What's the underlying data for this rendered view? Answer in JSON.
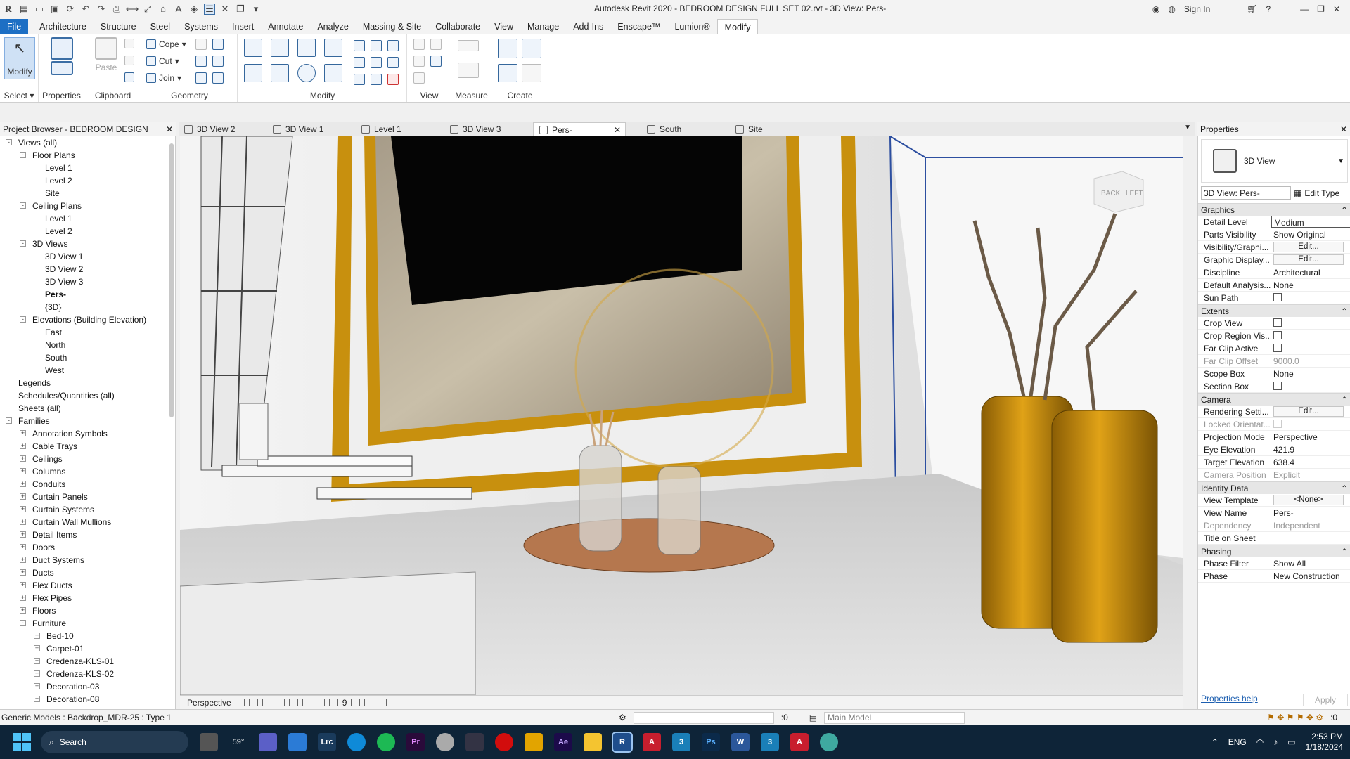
{
  "app": {
    "title": "Autodesk Revit 2020 - BEDROOM DESIGN FULL SET 02.rvt - 3D View: Pers-",
    "sign_in": "Sign In"
  },
  "ribbon_tabs": [
    "File",
    "Architecture",
    "Structure",
    "Steel",
    "Systems",
    "Insert",
    "Annotate",
    "Analyze",
    "Massing & Site",
    "Collaborate",
    "View",
    "Manage",
    "Add-Ins",
    "Enscape™",
    "Lumion®",
    "Modify"
  ],
  "active_tab": "Modify",
  "ribbon": {
    "select": {
      "modify_label": "Modify",
      "panel": "Select"
    },
    "properties": {
      "label": "Properties"
    },
    "clipboard": {
      "paste": "Paste",
      "panel": "Clipboard"
    },
    "geometry": {
      "cope": "Cope",
      "cut": "Cut",
      "join": "Join",
      "panel": "Geometry"
    },
    "modify_panel": "Modify",
    "view_panel": "View",
    "measure_panel": "Measure",
    "create_panel": "Create"
  },
  "project_browser": {
    "title": "Project Browser - BEDROOM DESIGN FUL...",
    "rows": [
      {
        "label": "Views (all)",
        "level": 0,
        "exp": "-"
      },
      {
        "label": "Floor Plans",
        "level": 1,
        "exp": "-"
      },
      {
        "label": "Level 1",
        "level": 2,
        "exp": ""
      },
      {
        "label": "Level 2",
        "level": 2,
        "exp": ""
      },
      {
        "label": "Site",
        "level": 2,
        "exp": ""
      },
      {
        "label": "Ceiling Plans",
        "level": 1,
        "exp": "-"
      },
      {
        "label": "Level 1",
        "level": 2,
        "exp": ""
      },
      {
        "label": "Level 2",
        "level": 2,
        "exp": ""
      },
      {
        "label": "3D Views",
        "level": 1,
        "exp": "-"
      },
      {
        "label": "3D View 1",
        "level": 2,
        "exp": ""
      },
      {
        "label": "3D View 2",
        "level": 2,
        "exp": ""
      },
      {
        "label": "3D View 3",
        "level": 2,
        "exp": ""
      },
      {
        "label": "Pers-",
        "level": 2,
        "exp": "",
        "bold": true
      },
      {
        "label": "{3D}",
        "level": 2,
        "exp": ""
      },
      {
        "label": "Elevations (Building Elevation)",
        "level": 1,
        "exp": "-"
      },
      {
        "label": "East",
        "level": 2,
        "exp": ""
      },
      {
        "label": "North",
        "level": 2,
        "exp": ""
      },
      {
        "label": "South",
        "level": 2,
        "exp": ""
      },
      {
        "label": "West",
        "level": 2,
        "exp": ""
      },
      {
        "label": "Legends",
        "level": 0,
        "exp": ""
      },
      {
        "label": "Schedules/Quantities (all)",
        "level": 0,
        "exp": ""
      },
      {
        "label": "Sheets (all)",
        "level": 0,
        "exp": ""
      },
      {
        "label": "Families",
        "level": 0,
        "exp": "-"
      },
      {
        "label": "Annotation Symbols",
        "level": 1,
        "exp": "+"
      },
      {
        "label": "Cable Trays",
        "level": 1,
        "exp": "+"
      },
      {
        "label": "Ceilings",
        "level": 1,
        "exp": "+"
      },
      {
        "label": "Columns",
        "level": 1,
        "exp": "+"
      },
      {
        "label": "Conduits",
        "level": 1,
        "exp": "+"
      },
      {
        "label": "Curtain Panels",
        "level": 1,
        "exp": "+"
      },
      {
        "label": "Curtain Systems",
        "level": 1,
        "exp": "+"
      },
      {
        "label": "Curtain Wall Mullions",
        "level": 1,
        "exp": "+"
      },
      {
        "label": "Detail Items",
        "level": 1,
        "exp": "+"
      },
      {
        "label": "Doors",
        "level": 1,
        "exp": "+"
      },
      {
        "label": "Duct Systems",
        "level": 1,
        "exp": "+"
      },
      {
        "label": "Ducts",
        "level": 1,
        "exp": "+"
      },
      {
        "label": "Flex Ducts",
        "level": 1,
        "exp": "+"
      },
      {
        "label": "Flex Pipes",
        "level": 1,
        "exp": "+"
      },
      {
        "label": "Floors",
        "level": 1,
        "exp": "+"
      },
      {
        "label": "Furniture",
        "level": 1,
        "exp": "-"
      },
      {
        "label": "Bed-10",
        "level": 2,
        "exp": "+"
      },
      {
        "label": "Carpet-01",
        "level": 2,
        "exp": "+"
      },
      {
        "label": "Credenza-KLS-01",
        "level": 2,
        "exp": "+"
      },
      {
        "label": "Credenza-KLS-02",
        "level": 2,
        "exp": "+"
      },
      {
        "label": "Decoration-03",
        "level": 2,
        "exp": "+"
      },
      {
        "label": "Decoration-08",
        "level": 2,
        "exp": "+"
      }
    ]
  },
  "view_tabs": [
    {
      "label": "3D View 2",
      "active": false
    },
    {
      "label": "3D View 1",
      "active": false
    },
    {
      "label": "Level 1",
      "active": false
    },
    {
      "label": "3D View 3",
      "active": false
    },
    {
      "label": "Pers-",
      "active": true
    },
    {
      "label": "South",
      "active": false
    },
    {
      "label": "Site",
      "active": false
    }
  ],
  "viewcube": {
    "back": "BACK",
    "left": "LEFT"
  },
  "view_bar": {
    "mode": "Perspective",
    "count": "9"
  },
  "properties": {
    "title": "Properties",
    "type": "3D View",
    "instance": "3D View: Pers-",
    "edit_type": "Edit Type",
    "sections": [
      {
        "name": "Graphics",
        "rows": [
          {
            "k": "Detail Level",
            "v": "Medium",
            "kind": "input"
          },
          {
            "k": "Parts Visibility",
            "v": "Show Original"
          },
          {
            "k": "Visibility/Graphi...",
            "v": "Edit...",
            "kind": "button"
          },
          {
            "k": "Graphic Display...",
            "v": "Edit...",
            "kind": "button"
          },
          {
            "k": "Discipline",
            "v": "Architectural"
          },
          {
            "k": "Default Analysis...",
            "v": "None"
          },
          {
            "k": "Sun Path",
            "v": "",
            "kind": "check"
          }
        ]
      },
      {
        "name": "Extents",
        "rows": [
          {
            "k": "Crop View",
            "v": "",
            "kind": "check"
          },
          {
            "k": "Crop Region Vis...",
            "v": "",
            "kind": "check"
          },
          {
            "k": "Far Clip Active",
            "v": "",
            "kind": "check"
          },
          {
            "k": "Far Clip Offset",
            "v": "9000.0",
            "gray": true
          },
          {
            "k": "Scope Box",
            "v": "None"
          },
          {
            "k": "Section Box",
            "v": "",
            "kind": "check"
          }
        ]
      },
      {
        "name": "Camera",
        "rows": [
          {
            "k": "Rendering Setti...",
            "v": "Edit...",
            "kind": "button"
          },
          {
            "k": "Locked Orientat...",
            "v": "",
            "kind": "check",
            "gray": true
          },
          {
            "k": "Projection Mode",
            "v": "Perspective"
          },
          {
            "k": "Eye Elevation",
            "v": "421.9"
          },
          {
            "k": "Target Elevation",
            "v": "638.4"
          },
          {
            "k": "Camera Position",
            "v": "Explicit",
            "gray": true
          }
        ]
      },
      {
        "name": "Identity Data",
        "rows": [
          {
            "k": "View Template",
            "v": "<None>",
            "kind": "button"
          },
          {
            "k": "View Name",
            "v": "Pers-"
          },
          {
            "k": "Dependency",
            "v": "Independent",
            "gray": true
          },
          {
            "k": "Title on Sheet",
            "v": ""
          }
        ]
      },
      {
        "name": "Phasing",
        "rows": [
          {
            "k": "Phase Filter",
            "v": "Show All"
          },
          {
            "k": "Phase",
            "v": "New Construction"
          }
        ]
      }
    ],
    "help": "Properties help",
    "apply": "Apply"
  },
  "status": {
    "text": "Generic Models : Backdrop_MDR-25 : Type 1",
    "count": ":0",
    "model": "Main Model",
    "filter": ":0"
  },
  "taskbar": {
    "search": "Search",
    "weather": "59°",
    "lang": "ENG",
    "time": "2:53 PM",
    "date": "1/18/2024"
  },
  "colors": {
    "accent": "#1d6fc4",
    "gold": "#c8900e",
    "taskbar": "#0e2438"
  }
}
